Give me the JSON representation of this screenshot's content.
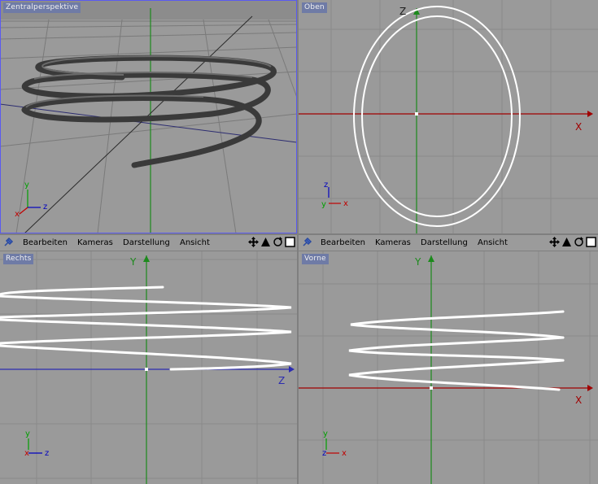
{
  "viewports": {
    "perspective": {
      "label": "Zentralperspektive",
      "axes": {
        "y": "y",
        "z": "z",
        "x": "x"
      }
    },
    "top": {
      "label": "Oben",
      "axis_z": "Z",
      "axis_x": "X",
      "axes": {
        "z": "z",
        "y": "y",
        "x": "x"
      }
    },
    "right": {
      "label": "Rechts",
      "axis_y": "Y",
      "axis_z": "Z",
      "axes": {
        "y": "y",
        "x": "x",
        "z": "z"
      }
    },
    "front": {
      "label": "Vorne",
      "axis_y": "Y",
      "axis_x": "X",
      "axes": {
        "y": "y",
        "z": "z",
        "x": "x"
      }
    }
  },
  "toolbar_left": {
    "menus": [
      "Bearbeiten",
      "Kameras",
      "Darstellung",
      "Ansicht"
    ]
  },
  "toolbar_right": {
    "menus": [
      "Bearbeiten",
      "Kameras",
      "Darstellung",
      "Ansicht"
    ]
  },
  "colors": {
    "accent": "#6f7ba6",
    "x_axis": "#c00000",
    "y_axis": "#00a000",
    "z_axis": "#0000c0"
  }
}
